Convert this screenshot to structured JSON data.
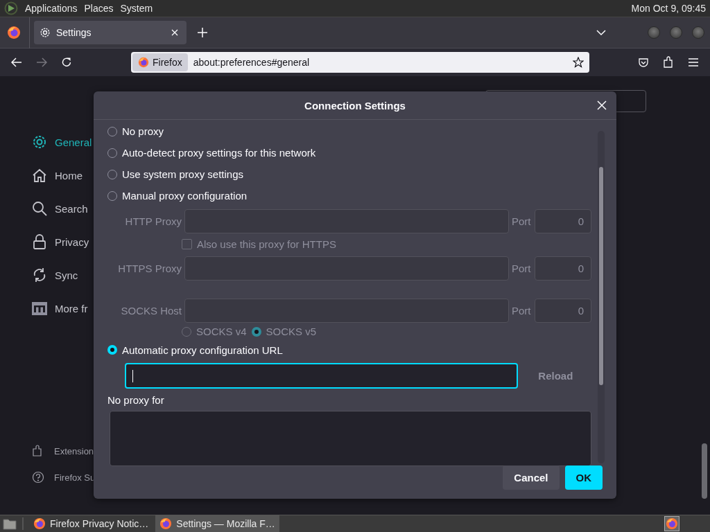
{
  "top_panel": {
    "menus": [
      "Applications",
      "Places",
      "System"
    ],
    "clock": "Mon Oct  9, 09:45"
  },
  "browser": {
    "tabs": [
      {
        "label": "Settings",
        "selected": true
      }
    ],
    "identity": "Firefox",
    "url": "about:preferences#general"
  },
  "sidebar": {
    "items": [
      {
        "label": "General",
        "kind": "gear",
        "selected": true
      },
      {
        "label": "Home",
        "kind": "home",
        "selected": false
      },
      {
        "label": "Search",
        "kind": "search",
        "selected": false
      },
      {
        "label": "Privacy",
        "kind": "lock",
        "selected": false
      },
      {
        "label": "Sync",
        "kind": "sync",
        "selected": false
      },
      {
        "label": "More fr",
        "kind": "logo",
        "selected": false
      }
    ],
    "footer_items": [
      {
        "label": "Extension",
        "kind": "puzzle"
      },
      {
        "label": "Firefox Su",
        "kind": "help"
      }
    ]
  },
  "dialog": {
    "title": "Connection Settings",
    "proxy_options": [
      {
        "label": "No proxy",
        "selected": false
      },
      {
        "label": "Auto-detect proxy settings for this network",
        "selected": false
      },
      {
        "label": "Use system proxy settings",
        "selected": false
      },
      {
        "label": "Manual proxy configuration",
        "selected": false
      }
    ],
    "manual": {
      "disabled": true,
      "rows": [
        {
          "label": "HTTP Proxy",
          "port_label": "Port",
          "port": "0"
        },
        {
          "label": "HTTPS Proxy",
          "port_label": "Port",
          "port": "0"
        },
        {
          "label": "SOCKS Host",
          "port_label": "Port",
          "port": "0"
        }
      ],
      "also_https": {
        "label": "Also use this proxy for HTTPS",
        "checked": false
      },
      "socks_versions": [
        {
          "label": "SOCKS v4",
          "selected": false
        },
        {
          "label": "SOCKS v5",
          "selected": true
        }
      ]
    },
    "auto_url": {
      "label": "Automatic proxy configuration URL",
      "selected": true,
      "focused": true,
      "reload": "Reload",
      "reload_disabled": true
    },
    "no_proxy_for": {
      "label": "No proxy for"
    },
    "buttons": [
      {
        "label": "Cancel",
        "kind": "secondary"
      },
      {
        "label": "OK",
        "kind": "primary"
      }
    ]
  },
  "taskbar": {
    "items": [
      {
        "label": "Firefox Privacy Notic…",
        "selected": false
      },
      {
        "label": "Settings — Mozilla F…",
        "selected": true
      }
    ]
  }
}
